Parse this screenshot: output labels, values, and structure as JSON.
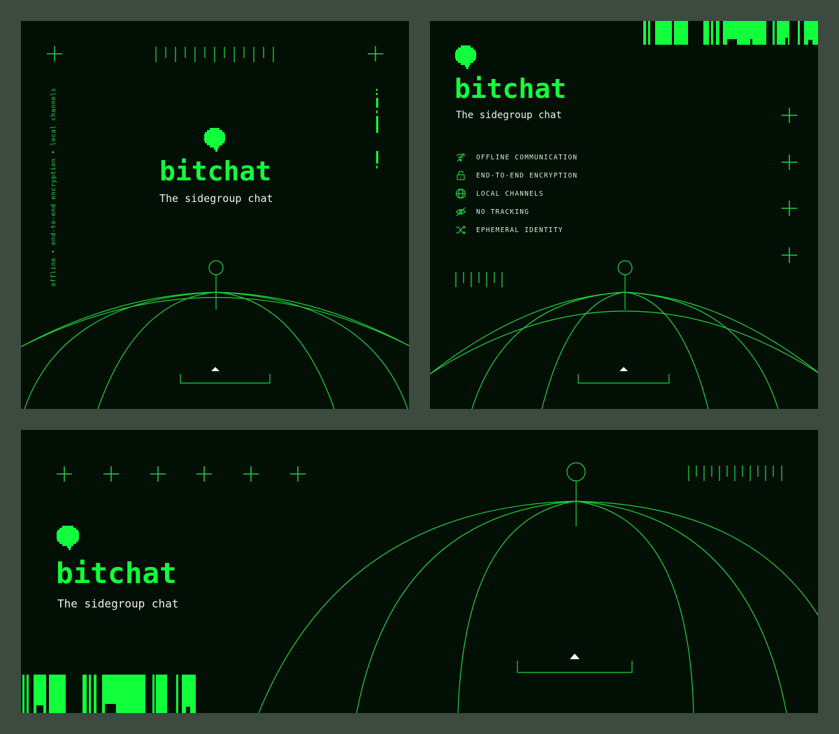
{
  "brand": {
    "name": "bitchat",
    "tagline": "The sidegroup chat"
  },
  "side_caption": {
    "items": [
      "offline",
      "end-to-end encryption",
      "local channels"
    ],
    "separator": "•"
  },
  "features": [
    {
      "icon": "wifi-off-icon",
      "label": "OFFLINE COMMUNICATION"
    },
    {
      "icon": "lock-icon",
      "label": "END-TO-END ENCRYPTION"
    },
    {
      "icon": "globe-icon",
      "label": "LOCAL CHANNELS"
    },
    {
      "icon": "eye-off-icon",
      "label": "NO TRACKING"
    },
    {
      "icon": "shuffle-icon",
      "label": "EPHEMERAL IDENTITY"
    }
  ],
  "colors": {
    "frame": "#3c4a40",
    "panel": "#010f04",
    "accent": "#12ff3c",
    "text": "#eaf3ea"
  }
}
